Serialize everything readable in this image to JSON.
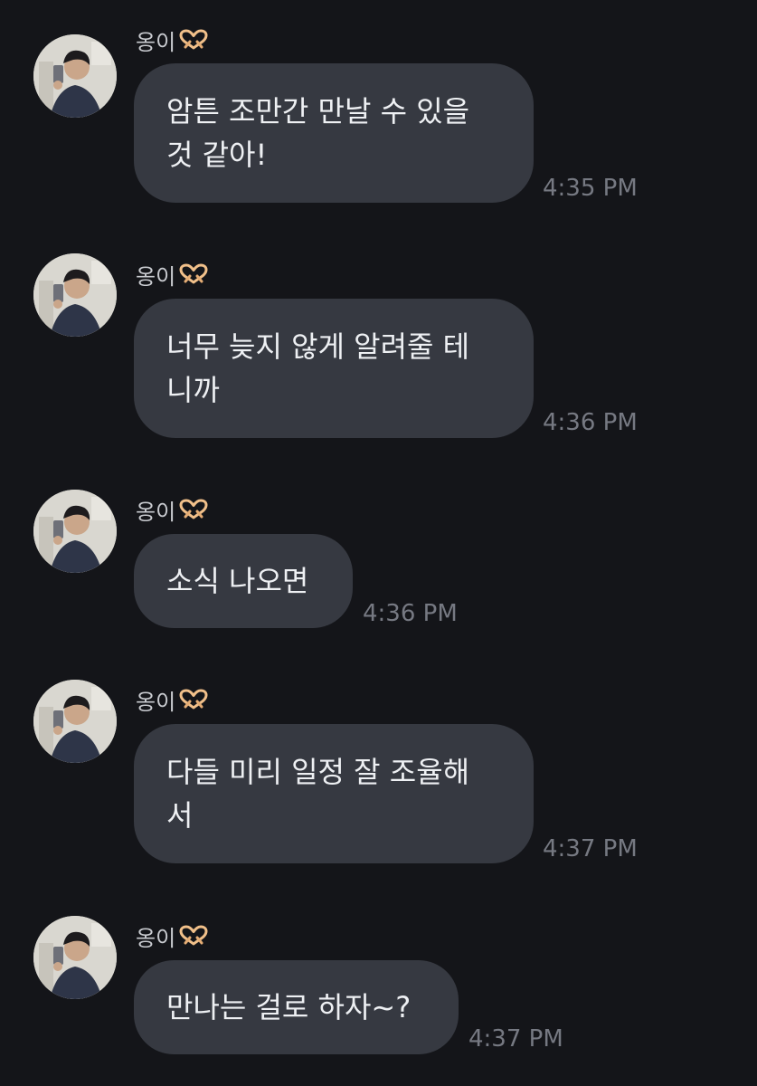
{
  "conversation": {
    "messages": [
      {
        "sender": "옹이",
        "text": "암튼 조만간 만날 수 있을\n것 같아!",
        "time": "4:35 PM"
      },
      {
        "sender": "옹이",
        "text": "너무 늦지 않게 알려줄 테\n니까",
        "time": "4:36 PM"
      },
      {
        "sender": "옹이",
        "text": "소식 나오면",
        "time": "4:36 PM"
      },
      {
        "sender": "옹이",
        "text": "다들 미리 일정 잘 조율해\n서",
        "time": "4:37 PM"
      },
      {
        "sender": "옹이",
        "text": "만나는 걸로 하자~?",
        "time": "4:37 PM"
      }
    ]
  },
  "icons": {
    "avatar": "user-avatar",
    "sender_badge": "heart-hands-emoji"
  },
  "colors": {
    "background": "#141519",
    "bubble": "#363941",
    "message_text": "#eef0f3",
    "sender_name": "#c9cbd0",
    "timestamp": "#767982"
  }
}
